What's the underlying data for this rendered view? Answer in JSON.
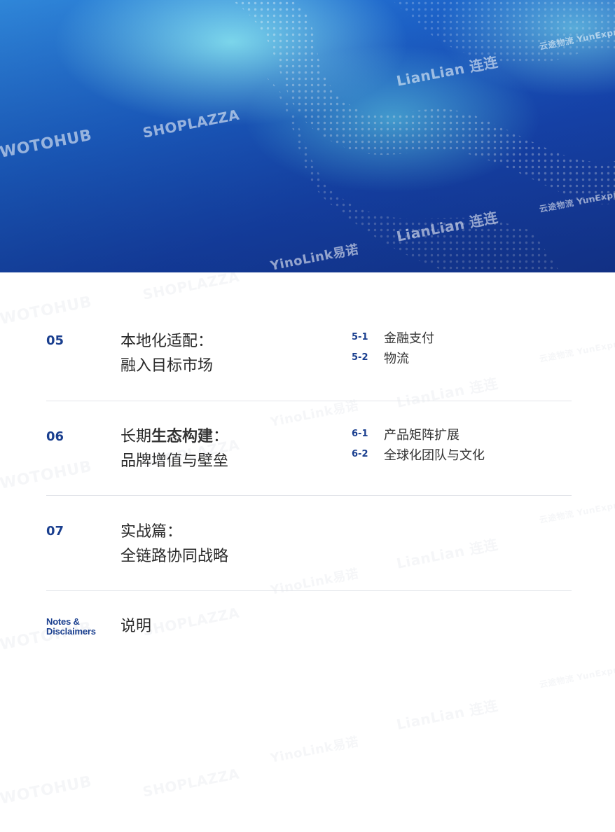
{
  "hero": {
    "watermarks": [
      "WOTOHUB",
      "SHOPLAZZA",
      "LianLian 连连",
      "YinoLink易诺",
      "云途物流 YunExpress"
    ]
  },
  "toc": [
    {
      "num": "05",
      "title_lines": [
        "本地化适配：",
        "融入目标市场"
      ],
      "subs": [
        {
          "num": "5-1",
          "label": "金融支付"
        },
        {
          "num": "5-2",
          "label": "物流"
        }
      ]
    },
    {
      "num": "06",
      "title_line1_pre": "长期",
      "title_line1_bold": "生态构建",
      "title_line1_post": "：",
      "title_line2": "品牌增值与壁垒",
      "subs": [
        {
          "num": "6-1",
          "label": "产品矩阵扩展"
        },
        {
          "num": "6-2",
          "label": "全球化团队与文化"
        }
      ]
    },
    {
      "num": "07",
      "title_lines": [
        "实战篇：",
        "全链路协同战略"
      ]
    }
  ],
  "notes": {
    "label_line1": "Notes &",
    "label_line2": "Disclaimers",
    "title": "说明"
  },
  "colors": {
    "accent": "#1a3f8f",
    "divider": "#e3e5ea",
    "hero_top": "#2f86d8",
    "hero_bottom": "#163a9a"
  }
}
